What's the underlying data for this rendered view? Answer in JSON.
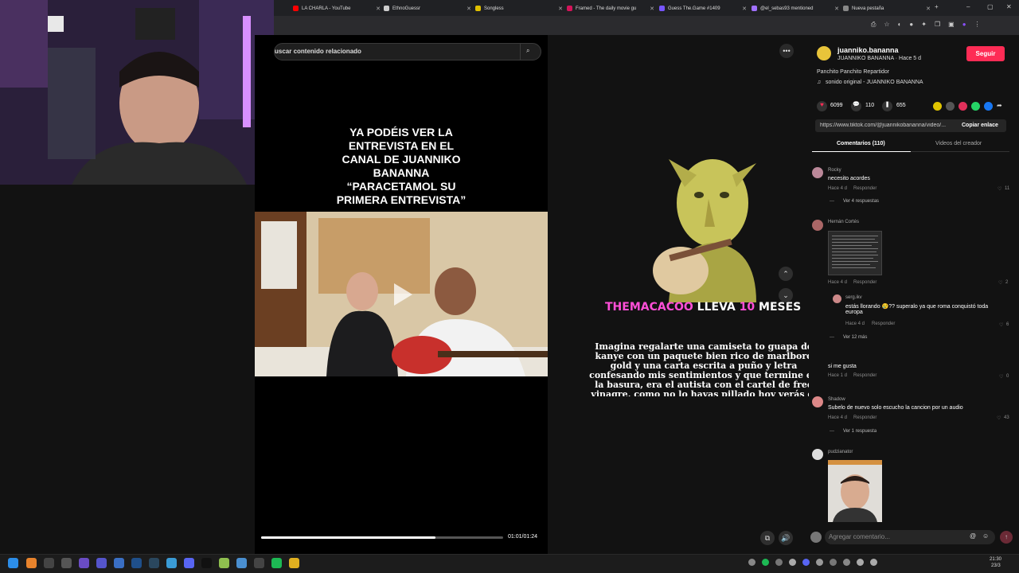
{
  "tabs": [
    {
      "label": "LA CHARLA - YouTube",
      "color": "#ff0000"
    },
    {
      "label": "EthnoGuessr",
      "color": "#cccccc"
    },
    {
      "label": "Songless",
      "color": "#e0c000"
    },
    {
      "label": "Framed - The daily movie gu",
      "color": "#d4145a"
    },
    {
      "label": "Guess The.Game #1409",
      "color": "#7755ff"
    },
    {
      "label": "@el_sebas93 mentioned",
      "color": "#a070ff"
    },
    {
      "label": "Nueva pestaña",
      "color": "#888888"
    }
  ],
  "search": {
    "text": "uscar contenido relacionado"
  },
  "video": {
    "caption_lines": [
      "YA PODÉIS VER LA",
      "ENTREVISTA EN EL",
      "CANAL DE JUANNIKO",
      "BANANNA",
      "“PARACETAMOL SU",
      "PRIMERA ENTREVISTA”"
    ],
    "time": "01:01/01:24",
    "progress_fraction": 0.72
  },
  "next_video": {
    "title_parts": [
      "THEMACACOO",
      "LLEVA",
      "10",
      "MESES"
    ],
    "text": "Imagina regalarte una camiseta to guapa de kanye con un paquete bien rico de marlboro gold y una carta escrita a puño y letra confesando mis sentimientos y que termine en la basura, era el autista con el cartel de free vinagre, como no lo hayas pillado hoy verás el nacimiento de tu mayor hater"
  },
  "author": {
    "username": "juanniko.bananna",
    "display": "JUANNIKO BANANNA · Hace 5 d",
    "follow_label": "Seguir",
    "description": "Panchito Panchito Repartidor",
    "sound": "sonido original - JUANNIKO BANANNA"
  },
  "stats": {
    "likes": "6099",
    "comments": "110",
    "saves": "655"
  },
  "share": {
    "url": "https://www.tiktok.com/@juannikobananna/video/...",
    "copy_label": "Copiar enlace"
  },
  "tabs_panel": {
    "comments": "Comentarios (110)",
    "creator_videos": "Videos del creador"
  },
  "comments": [
    {
      "name": "Rocky",
      "text": "necesito acordes",
      "time": "Hace 4 d",
      "reply": "Responder",
      "likes": "11",
      "more": "Ver 4 respuestas"
    },
    {
      "name": "Hernán Cortés",
      "text": "",
      "time": "Hace 4 d",
      "reply": "Responder",
      "likes": "2"
    },
    {
      "name": "serg.ikv",
      "text": "estás llorando 😢?? superalo ya que roma conquistó toda europa",
      "time": "Hace 4 d",
      "reply": "Responder",
      "likes": "6",
      "more": "Ver 12 más"
    },
    {
      "name": ".",
      "text": "si me gusta",
      "time": "Hace 1 d",
      "reply": "Responder",
      "likes": "0"
    },
    {
      "name": "Shadow",
      "text": "Subelo de nuevo solo escucho la cancion por un audio",
      "time": "Hace 4 d",
      "reply": "Responder",
      "likes": "43",
      "more": "Ver 1 respuesta"
    },
    {
      "name": "pudzianator",
      "text": "",
      "time": "",
      "reply": "",
      "likes": ""
    }
  ],
  "comment_input": {
    "placeholder": "Agregar comentario..."
  },
  "clock": {
    "time": "21:30",
    "date": "23/3"
  }
}
